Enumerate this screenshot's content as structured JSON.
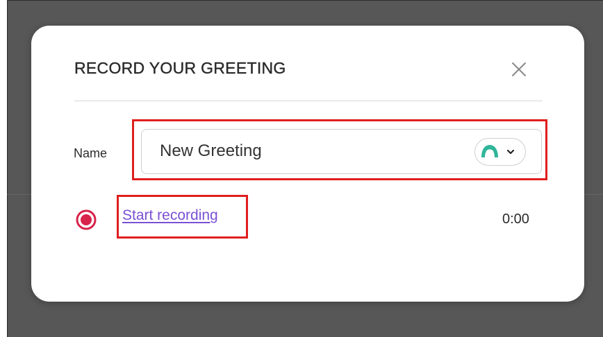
{
  "dialog": {
    "title": "RECORD YOUR GREETING"
  },
  "name_field": {
    "label": "Name",
    "value": "New Greeting"
  },
  "recording": {
    "link_label": "Start recording",
    "elapsed": "0:00"
  },
  "icons": {
    "close": "close-icon",
    "voice_avatar": "voice-avatar-icon",
    "chevron": "chevron-down-icon",
    "record": "record-icon"
  },
  "colors": {
    "backdrop": "#575757",
    "highlight": "#e01e1e",
    "link": "#7b50d4",
    "record": "#d8234a",
    "avatar": "#2fb59a"
  }
}
